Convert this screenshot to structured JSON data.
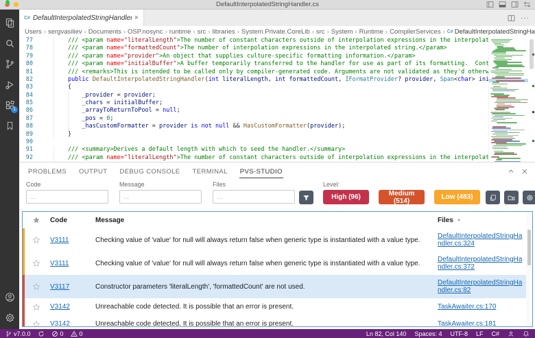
{
  "title_bar": {
    "title": "DefaultInterpolatedStringHandler.cs"
  },
  "tab": {
    "label": "DefaultInterpolatedStringHandler.cs",
    "close": "×"
  },
  "tabbar_actions": {
    "more": "···"
  },
  "activity_bar": {
    "extensions_badge": "1"
  },
  "breadcrumb": {
    "segments": [
      "Users",
      "sergvasiliev",
      "Documents",
      "OSP.nosync",
      "runtime",
      "src",
      "libraries",
      "System.Private.CoreLib",
      "src",
      "System",
      "Runtime",
      "CompilerServices",
      "DefaultInterpolatedStringHandler.cs"
    ]
  },
  "editor": {
    "lines": [
      {
        "n": 77,
        "toks": [
          [
            "cmt",
            "        /// <param"
          ],
          [
            "attr",
            " name="
          ],
          [
            "str",
            "\"literalLength\""
          ],
          [
            "cmt",
            ">The number of constant characters outside of interpolation expressions in the interpolated string.</param>"
          ]
        ]
      },
      {
        "n": 78,
        "toks": [
          [
            "cmt",
            "        /// <param"
          ],
          [
            "attr",
            " name="
          ],
          [
            "str",
            "\"formattedCount\""
          ],
          [
            "cmt",
            ">The number of interpolation expressions in the interpolated string.</param>"
          ]
        ]
      },
      {
        "n": 79,
        "toks": [
          [
            "cmt",
            "        /// <param"
          ],
          [
            "attr",
            " name="
          ],
          [
            "str",
            "\"provider\""
          ],
          [
            "cmt",
            ">An object that supplies culture-specific formatting information.</param>"
          ]
        ]
      },
      {
        "n": 80,
        "toks": [
          [
            "cmt",
            "        /// <param"
          ],
          [
            "attr",
            " name="
          ],
          [
            "str",
            "\"initialBuffer\""
          ],
          [
            "cmt",
            ">A buffer temporarily transferred to the handler for use as part of its formatting.  Contents may be overwritten.</param>"
          ]
        ]
      },
      {
        "n": 81,
        "toks": [
          [
            "cmt",
            "        /// <remarks>This is intended to be called only by compiler-generated code. Arguments are not validated as they'd otherwise be for members intended to be used directly.</remarks>"
          ]
        ]
      },
      {
        "n": 82,
        "toks": [
          [
            "pln",
            "        "
          ],
          [
            "kw",
            "public"
          ],
          [
            "pln",
            " "
          ],
          [
            "mth",
            "DefaultInterpolatedStringHandler"
          ],
          [
            "pln",
            "("
          ],
          [
            "kw",
            "int"
          ],
          [
            "pln",
            " "
          ],
          [
            "var",
            "literalLength"
          ],
          [
            "pln",
            ", "
          ],
          [
            "kw",
            "int"
          ],
          [
            "pln",
            " "
          ],
          [
            "var",
            "formattedCount"
          ],
          [
            "pln",
            ", "
          ],
          [
            "typ",
            "IFormatProvider"
          ],
          [
            "pln",
            "? "
          ],
          [
            "var",
            "provider"
          ],
          [
            "pln",
            ", "
          ],
          [
            "typ",
            "Span"
          ],
          [
            "pln",
            "<"
          ],
          [
            "kw",
            "char"
          ],
          [
            "pln",
            "> "
          ],
          [
            "var",
            "initialBuffer"
          ],
          [
            "pln",
            ")"
          ]
        ]
      },
      {
        "n": 83,
        "toks": [
          [
            "pln",
            "        {"
          ]
        ]
      },
      {
        "n": 84,
        "toks": [
          [
            "pln",
            "            "
          ],
          [
            "var",
            "_provider"
          ],
          [
            "pln",
            " = "
          ],
          [
            "var",
            "provider"
          ],
          [
            "pln",
            ";"
          ]
        ]
      },
      {
        "n": 85,
        "toks": [
          [
            "pln",
            "            "
          ],
          [
            "var",
            "_chars"
          ],
          [
            "pln",
            " = "
          ],
          [
            "var",
            "initialBuffer"
          ],
          [
            "pln",
            ";"
          ]
        ]
      },
      {
        "n": 86,
        "toks": [
          [
            "pln",
            "            "
          ],
          [
            "var",
            "_arrayToReturnToPool"
          ],
          [
            "pln",
            " = "
          ],
          [
            "kw",
            "null"
          ],
          [
            "pln",
            ";"
          ]
        ]
      },
      {
        "n": 87,
        "toks": [
          [
            "pln",
            "            "
          ],
          [
            "var",
            "_pos"
          ],
          [
            "pln",
            " = "
          ],
          [
            "num",
            "0"
          ],
          [
            "pln",
            ";"
          ]
        ]
      },
      {
        "n": 88,
        "toks": [
          [
            "pln",
            "            "
          ],
          [
            "var",
            "_hasCustomFormatter"
          ],
          [
            "pln",
            " = "
          ],
          [
            "var",
            "provider"
          ],
          [
            "pln",
            " "
          ],
          [
            "kw",
            "is"
          ],
          [
            "pln",
            " "
          ],
          [
            "kw",
            "not"
          ],
          [
            "pln",
            " "
          ],
          [
            "kw",
            "null"
          ],
          [
            "pln",
            " && "
          ],
          [
            "mth",
            "HasCustomFormatter"
          ],
          [
            "pln",
            "("
          ],
          [
            "var",
            "provider"
          ],
          [
            "pln",
            ");"
          ]
        ]
      },
      {
        "n": 89,
        "toks": [
          [
            "pln",
            "        }"
          ]
        ]
      },
      {
        "n": 90,
        "toks": []
      },
      {
        "n": 91,
        "toks": [
          [
            "cmt",
            "        /// <summary>Derives a default length with which to seed the handler.</summary>"
          ]
        ]
      },
      {
        "n": 92,
        "toks": [
          [
            "cmt",
            "        /// <param"
          ],
          [
            "attr",
            " name="
          ],
          [
            "str",
            "\"literalLength\""
          ],
          [
            "cmt",
            ">The number of constant characters outside of interpolation expressions in the interpolated string.</param>"
          ]
        ]
      }
    ]
  },
  "panel": {
    "tabs": [
      "PROBLEMS",
      "OUTPUT",
      "DEBUG CONSOLE",
      "TERMINAL",
      "PVS-STUDIO"
    ],
    "active_index": 4,
    "filters": {
      "code_label": "Code",
      "message_label": "Message",
      "files_label": "Files",
      "placeholder": "...",
      "level_label": "Level:"
    },
    "levels": [
      {
        "key": "high",
        "label": "High (96)"
      },
      {
        "key": "medium",
        "label": "Medium (514)"
      },
      {
        "key": "low",
        "label": "Low (483)"
      }
    ],
    "table": {
      "headers": {
        "code": "Code",
        "message": "Message",
        "files": "Files"
      },
      "rows": [
        {
          "severity": "low",
          "code": "V3111",
          "message": "Checking value of 'value' for null will always return false when generic type is instantiated with a value type.",
          "file": "DefaultInterpolatedStringHandler.cs:324",
          "selected": false
        },
        {
          "severity": "low",
          "code": "V3111",
          "message": "Checking value of 'value' for null will always return false when generic type is instantiated with a value type.",
          "file": "DefaultInterpolatedStringHandler.cs:372",
          "selected": false
        },
        {
          "severity": "medium",
          "code": "V3117",
          "message": "Constructor parameters 'literalLength', 'formattedCount' are not used.",
          "file": "DefaultInterpolatedStringHandler.cs:82",
          "selected": true
        },
        {
          "severity": "medium",
          "code": "V3142",
          "message": "Unreachable code detected. It is possible that an error is present.",
          "file": "TaskAwaiter.cs:170",
          "selected": false
        },
        {
          "severity": "medium",
          "code": "V3142",
          "message": "Unreachable code detected. It is possible that an error is present.",
          "file": "TaskAwaiter.cs:181",
          "selected": false
        }
      ]
    }
  },
  "status_bar": {
    "version": "v7.0.0",
    "errors": "0",
    "warnings": "0",
    "cursor": "Ln 82, Col 140",
    "spaces": "Spaces: 4",
    "encoding": "UTF-8",
    "eol": "LF",
    "language": "C#"
  },
  "colors": {
    "high": "#c4314b",
    "medium": "#d4532b",
    "low": "#f9a72b",
    "severity_medium": "#e04a2e",
    "severity_low": "#f5a623",
    "table_border": "#5b9bd5",
    "link": "#1567b3",
    "status_bar_bg": "#68217a"
  }
}
